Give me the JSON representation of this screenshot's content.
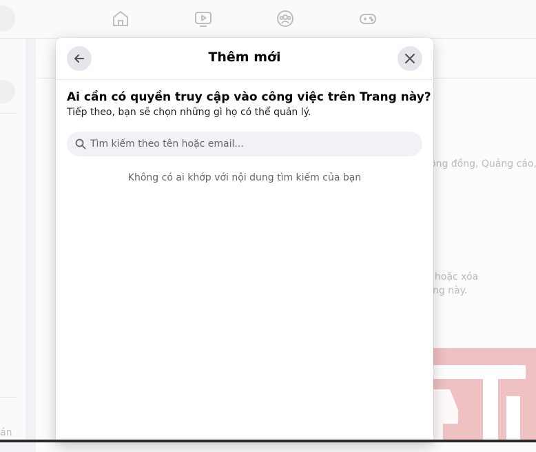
{
  "modal": {
    "title": "Thêm mới",
    "question": "Ai cần có quyền truy cập vào công việc trên Trang này?",
    "subtext": "Tiếp theo, bạn sẽ chọn những gì họ có thể quản lý.",
    "search": {
      "placeholder": "Tìm kiếm theo tên hoặc email...",
      "value": ""
    },
    "empty_message": "Không có ai khớp với nội dung tìm kiếm của bạn"
  },
  "background": {
    "text_1": "ộng đồng, Quảng cáo,",
    "text_2": "hoặc xóa",
    "text_3": "ng này.",
    "left_text": "án"
  },
  "icons": {
    "nav": [
      "home-icon",
      "video-icon",
      "groups-icon",
      "gaming-icon"
    ],
    "modal": [
      "back-arrow-icon",
      "close-icon",
      "search-icon"
    ]
  }
}
